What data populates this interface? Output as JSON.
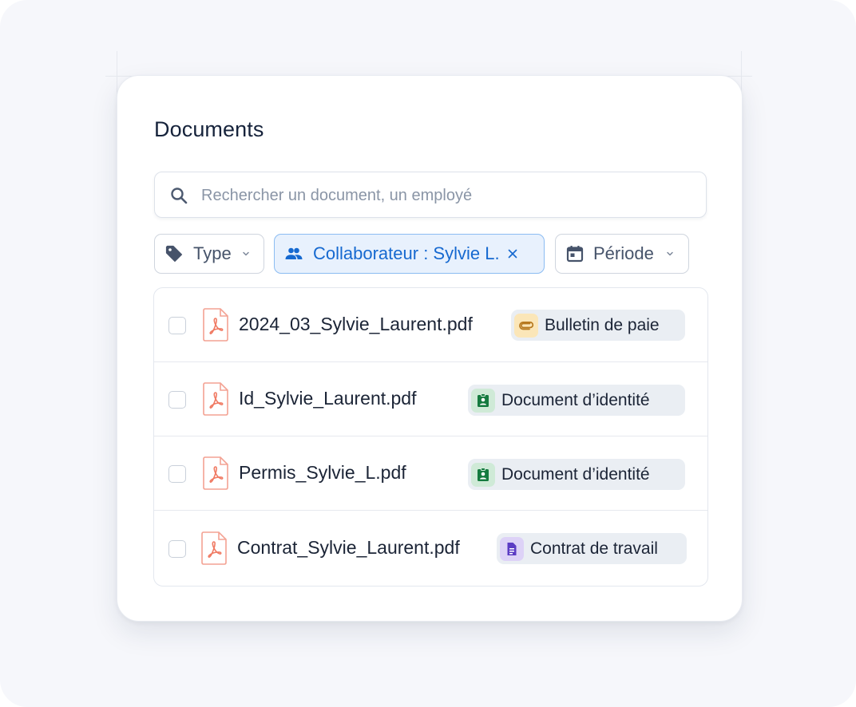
{
  "panel": {
    "title": "Documents"
  },
  "search": {
    "placeholder": "Rechercher un document, un employé",
    "value": ""
  },
  "filters": [
    {
      "label": "Type",
      "icon": "tag-icon",
      "active": false
    },
    {
      "label": "Collaborateur : Sylvie L.",
      "icon": "people-icon",
      "active": true
    },
    {
      "label": "Période",
      "icon": "calendar-icon",
      "active": false
    }
  ],
  "documents": [
    {
      "filename": "2024_03_Sylvie_Laurent.pdf",
      "category": "Bulletin de paie",
      "category_icon": "paperclip-icon",
      "checked": false
    },
    {
      "filename": "Id_Sylvie_Laurent.pdf",
      "category": "Document d’identité",
      "category_icon": "id-badge-icon",
      "checked": false
    },
    {
      "filename": "Permis_Sylvie_L.pdf",
      "category": "Document d’identité",
      "category_icon": "id-badge-icon",
      "checked": false
    },
    {
      "filename": "Contrat_Sylvie_Laurent.pdf",
      "category": "Contrat de travail",
      "category_icon": "document-icon",
      "checked": false
    }
  ],
  "colors": {
    "accent": "#1669d0",
    "active_filter_bg": "#e8f1fd",
    "pdf_icon": "#f07a63",
    "payslip_badge": "#fbe6b8",
    "identity_badge": "#dcefe0",
    "contract_badge": "#e4dcf9"
  }
}
